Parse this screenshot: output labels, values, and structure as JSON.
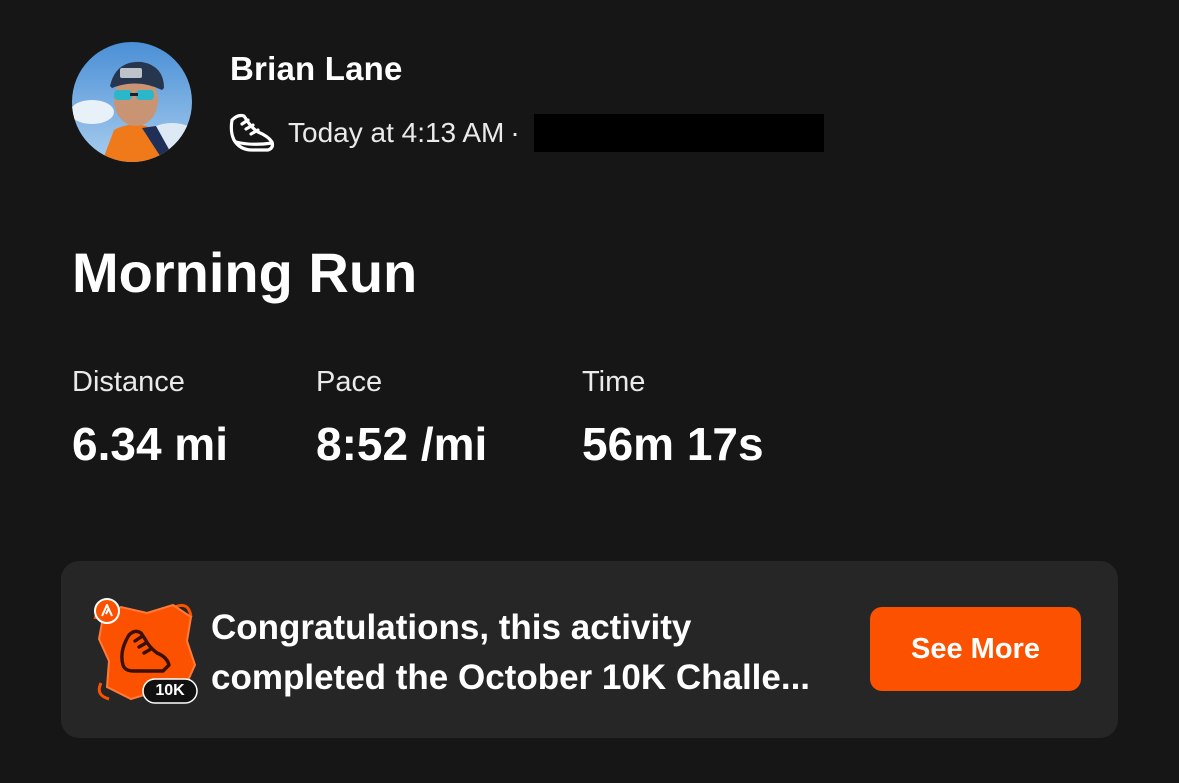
{
  "athlete": {
    "name": "Brian Lane",
    "avatar_icon": "profile-photo"
  },
  "activity": {
    "sport_icon": "running-shoe-icon",
    "timestamp": "Today at 4:13 AM",
    "separator": "·",
    "location_redacted": true,
    "title": "Morning Run"
  },
  "stats": [
    {
      "label": "Distance",
      "value": "6.34 mi"
    },
    {
      "label": "Pace",
      "value": "8:52 /mi"
    },
    {
      "label": "Time",
      "value": "56m 17s"
    }
  ],
  "challenge": {
    "message_line1": "Congratulations, this activity",
    "message_line2": "completed the October 10K Challe...",
    "badge_label": "10K",
    "button_label": "See More"
  },
  "colors": {
    "background": "#161616",
    "card": "#262626",
    "accent": "#fc5200",
    "text": "#ffffff"
  }
}
